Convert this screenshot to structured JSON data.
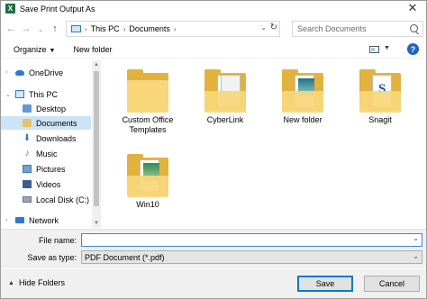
{
  "window": {
    "title": "Save Print Output As",
    "app_icon": "excel-icon",
    "close_glyph": "✕"
  },
  "nav": {
    "back_glyph": "←",
    "forward_glyph": "→",
    "recent_glyph": "⌄",
    "up_glyph": "↑"
  },
  "address": {
    "segments": [
      "This PC",
      "Documents"
    ]
  },
  "search": {
    "placeholder": "Search Documents"
  },
  "toolbar": {
    "organize_label": "Organize",
    "new_folder_label": "New folder",
    "help_label": "?"
  },
  "sidebar": {
    "items": [
      {
        "label": "OneDrive",
        "icon": "onedrive-icon"
      },
      {
        "label": "This PC",
        "icon": "computer-icon"
      },
      {
        "label": "Desktop",
        "icon": "desktop-folder-icon"
      },
      {
        "label": "Documents",
        "icon": "documents-folder-icon",
        "selected": true
      },
      {
        "label": "Downloads",
        "icon": "downloads-icon"
      },
      {
        "label": "Music",
        "icon": "music-icon"
      },
      {
        "label": "Pictures",
        "icon": "pictures-icon"
      },
      {
        "label": "Videos",
        "icon": "videos-icon"
      },
      {
        "label": "Local Disk (C:)",
        "icon": "disk-icon"
      },
      {
        "label": "Network",
        "icon": "network-icon"
      }
    ]
  },
  "folders": [
    {
      "label": "Custom Office\nTemplates",
      "style": "empty"
    },
    {
      "label": "CyberLink",
      "style": "docs"
    },
    {
      "label": "New folder",
      "style": "photo"
    },
    {
      "label": "Snagit",
      "style": "snagit"
    },
    {
      "label": "Win10",
      "style": "photo-open"
    }
  ],
  "fields": {
    "file_name_label": "File name:",
    "file_name_value": "",
    "save_type_label": "Save as type:",
    "save_type_value": "PDF Document (*.pdf)"
  },
  "footer": {
    "hide_folders_label": "Hide Folders",
    "save_label": "Save",
    "cancel_label": "Cancel"
  },
  "colors": {
    "accent": "#0078d7",
    "selected_bg": "#cce4f7",
    "folder": "#f8d77a"
  }
}
